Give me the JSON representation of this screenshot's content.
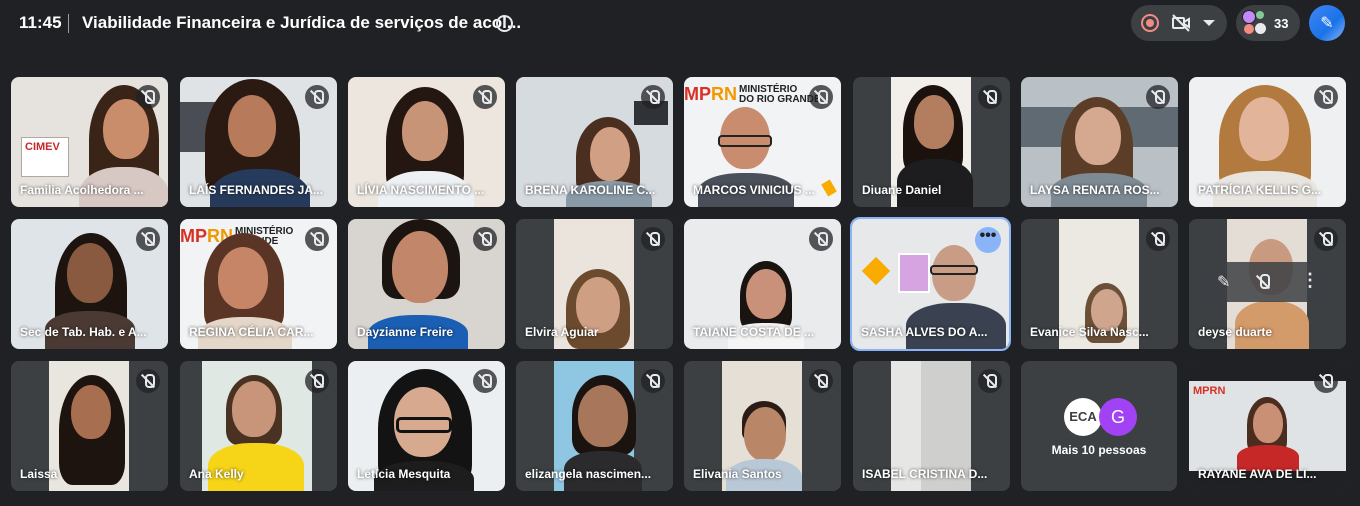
{
  "header": {
    "time": "11:45",
    "title": "Viabilidade Financeira e Jurídica de serviços de acol...",
    "participant_count": "33"
  },
  "icons": {
    "info": "info-icon",
    "recording": "recording-icon",
    "camera_off": "camera-off-icon",
    "people": "people-icon",
    "ai": "gemini-icon"
  },
  "colors": {
    "accent": "#8ab4f8",
    "background": "#202124",
    "tile": "#3c4043",
    "recording": "#f28b82"
  },
  "participants": [
    {
      "name": "Familia Acolhedora ...",
      "muted": true
    },
    {
      "name": "LAÍS FERNANDES JA...",
      "muted": true
    },
    {
      "name": "LÍVIA NASCIMENTO ...",
      "muted": true
    },
    {
      "name": "BRENA KAROLINE C...",
      "muted": true
    },
    {
      "name": "MARCOS VINICIUS ...",
      "muted": true
    },
    {
      "name": "Diuane Daniel",
      "muted": true
    },
    {
      "name": "LAYSA RENATA ROS...",
      "muted": true
    },
    {
      "name": "PATRÍCIA KELLIS G...",
      "muted": true
    },
    {
      "name": "Sec de Tab. Hab. e A...",
      "muted": true
    },
    {
      "name": "REGINA CÉLIA CAR...",
      "muted": true
    },
    {
      "name": "Dayzianne Freire",
      "muted": true
    },
    {
      "name": "Elvira Aguiar",
      "muted": true
    },
    {
      "name": "TAIANE COSTA DE ...",
      "muted": true
    },
    {
      "name": "SASHA ALVES DO A...",
      "muted": false
    },
    {
      "name": "Evanice Silva Nasc...",
      "muted": true
    },
    {
      "name": "deyse duarte",
      "muted": true
    },
    {
      "name": "Laissa",
      "muted": true
    },
    {
      "name": "Ana Kelly",
      "muted": true
    },
    {
      "name": "Letícia Mesquita",
      "muted": true
    },
    {
      "name": "elizangela nascimen...",
      "muted": true
    },
    {
      "name": "Elivania Santos",
      "muted": true
    },
    {
      "name": "ISABEL CRISTINA D...",
      "muted": true
    },
    {
      "name": "RAYANE AVA DE LI...",
      "muted": true
    }
  ],
  "others_tile": {
    "label": "Mais 10 pessoas",
    "avatar_initial": "G"
  }
}
